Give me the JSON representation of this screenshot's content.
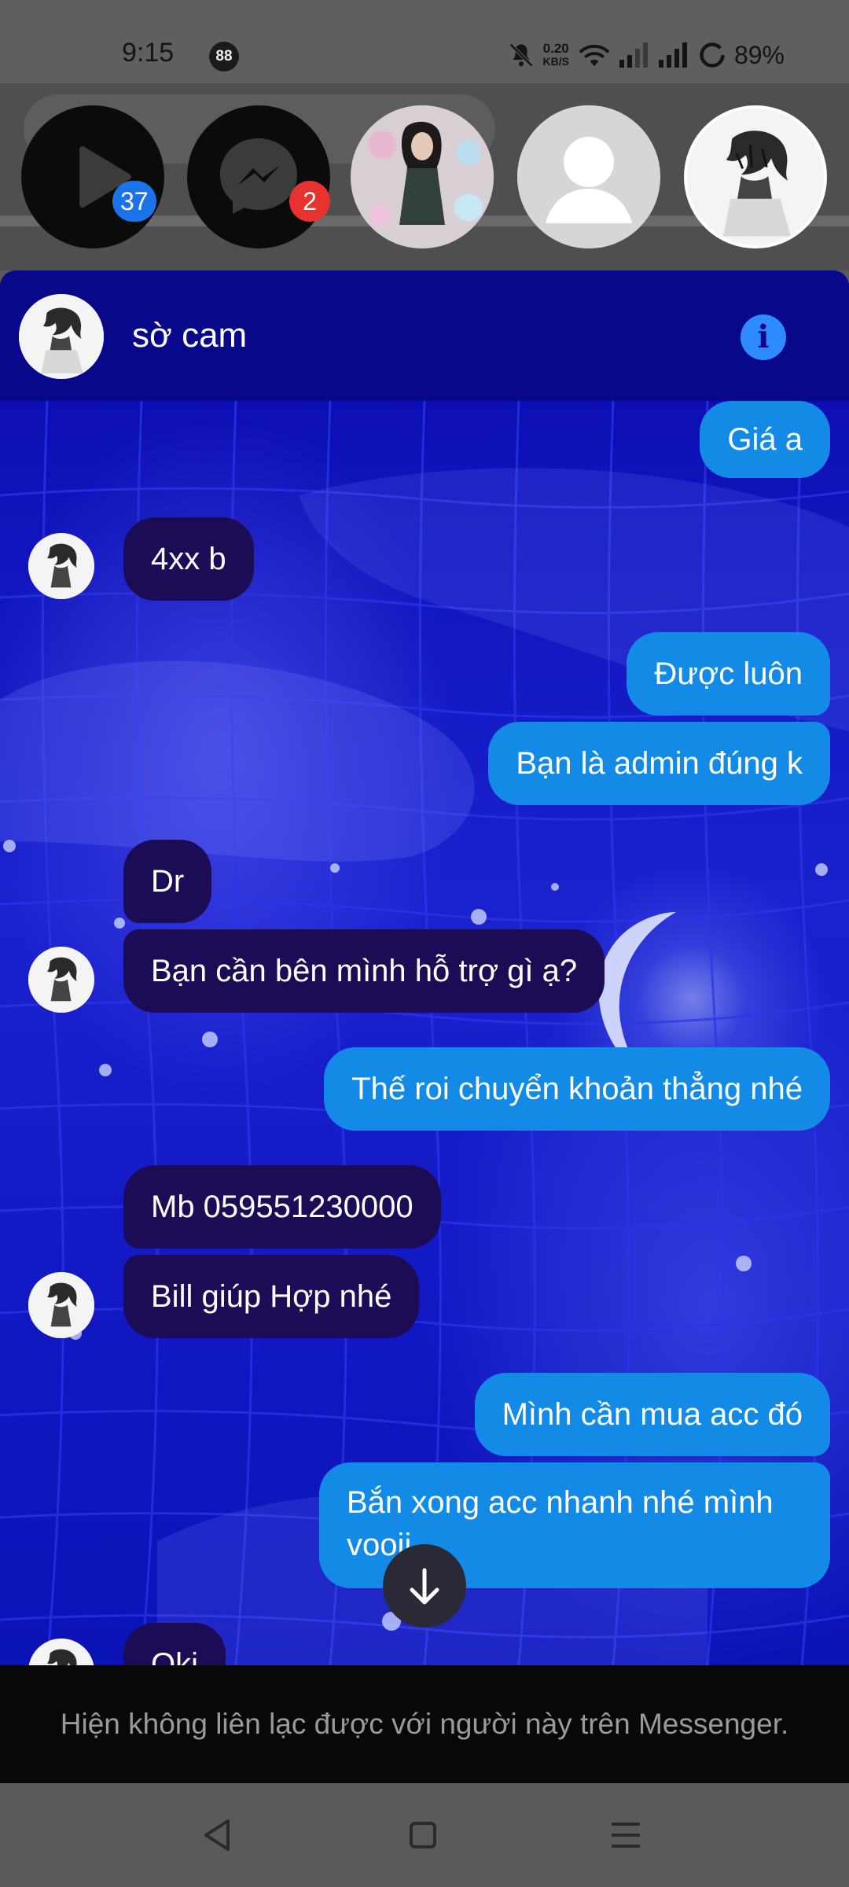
{
  "status_bar": {
    "time": "9:15",
    "notification_badge": "88",
    "net_speed_value": "0.20",
    "net_speed_unit": "KB/S",
    "battery": "89%"
  },
  "chat_heads": {
    "video_badge": "37",
    "messenger_badge": "2"
  },
  "chat": {
    "contact_name": "sờ cam",
    "messages": [
      {
        "side": "out",
        "text": "Giá a"
      },
      {
        "side": "in",
        "text": "4xx b"
      },
      {
        "side": "out",
        "text": "Được luôn"
      },
      {
        "side": "out",
        "text": "Bạn là admin đúng k"
      },
      {
        "side": "in",
        "text": "Dr"
      },
      {
        "side": "in",
        "text": "Bạn cần bên mình hỗ trợ gì ạ?"
      },
      {
        "side": "out",
        "text": "Thế roi chuyển khoản thẳng nhé"
      },
      {
        "side": "in",
        "text": "Mb 059551230000"
      },
      {
        "side": "in",
        "text": "Bill giúp Hợp nhé"
      },
      {
        "side": "out",
        "text": "Mình cần mua acc đó"
      },
      {
        "side": "out",
        "text": "Bắn xong acc nhanh nhé mình vooii"
      },
      {
        "side": "in",
        "text": "Oki"
      }
    ],
    "footer_notice": "Hiện không liên lạc được với người này trên Messenger."
  },
  "colors": {
    "outgoing_bubble": "#138be6",
    "incoming_bubble": "#1c0b55",
    "theme_background": "#0b0fa8",
    "badge_blue": "#1a73e8",
    "badge_red": "#e8322f"
  },
  "icons": {
    "status": [
      "mute-icon",
      "wifi-icon",
      "signal-icon",
      "signal-icon",
      "battery-saver-icon"
    ],
    "heads": [
      "play-icon",
      "messenger-icon"
    ],
    "header": "info-icon",
    "scroll": "arrow-down-icon",
    "nav": [
      "back-icon",
      "home-icon",
      "recents-icon"
    ]
  }
}
